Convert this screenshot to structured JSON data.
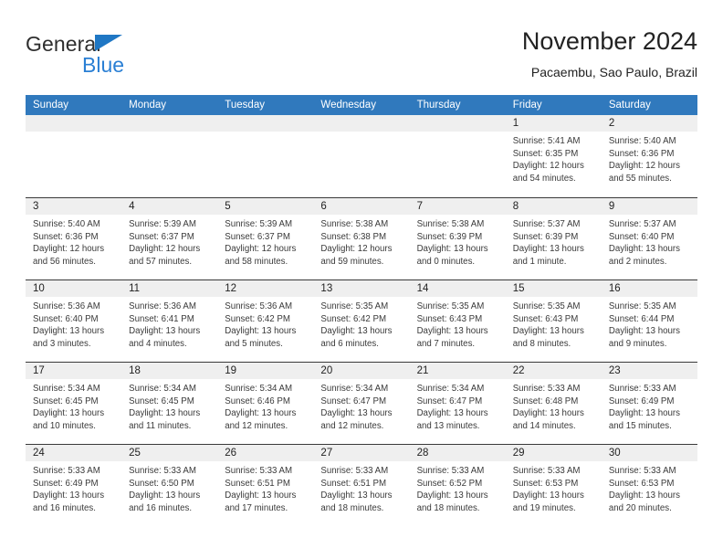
{
  "brand": {
    "name_part1": "General",
    "name_part2": "Blue",
    "triangle_color": "#1f77c4",
    "blue_color": "#2a7fd4"
  },
  "header": {
    "title": "November 2024",
    "subtitle": "Pacaembu, Sao Paulo, Brazil"
  },
  "colors": {
    "header_row_bg": "#3079bd",
    "day_band_bg": "#efefef",
    "cell_bg": "#ffffff",
    "grid_line": "#3a3a3a",
    "text": "#3a3a3a"
  },
  "weekdays": [
    "Sunday",
    "Monday",
    "Tuesday",
    "Wednesday",
    "Thursday",
    "Friday",
    "Saturday"
  ],
  "weeks": [
    [
      {
        "day": "",
        "sunrise": "",
        "sunset": "",
        "daylight_line1": "",
        "daylight_line2": ""
      },
      {
        "day": "",
        "sunrise": "",
        "sunset": "",
        "daylight_line1": "",
        "daylight_line2": ""
      },
      {
        "day": "",
        "sunrise": "",
        "sunset": "",
        "daylight_line1": "",
        "daylight_line2": ""
      },
      {
        "day": "",
        "sunrise": "",
        "sunset": "",
        "daylight_line1": "",
        "daylight_line2": ""
      },
      {
        "day": "",
        "sunrise": "",
        "sunset": "",
        "daylight_line1": "",
        "daylight_line2": ""
      },
      {
        "day": "1",
        "sunrise": "Sunrise: 5:41 AM",
        "sunset": "Sunset: 6:35 PM",
        "daylight_line1": "Daylight: 12 hours",
        "daylight_line2": "and 54 minutes."
      },
      {
        "day": "2",
        "sunrise": "Sunrise: 5:40 AM",
        "sunset": "Sunset: 6:36 PM",
        "daylight_line1": "Daylight: 12 hours",
        "daylight_line2": "and 55 minutes."
      }
    ],
    [
      {
        "day": "3",
        "sunrise": "Sunrise: 5:40 AM",
        "sunset": "Sunset: 6:36 PM",
        "daylight_line1": "Daylight: 12 hours",
        "daylight_line2": "and 56 minutes."
      },
      {
        "day": "4",
        "sunrise": "Sunrise: 5:39 AM",
        "sunset": "Sunset: 6:37 PM",
        "daylight_line1": "Daylight: 12 hours",
        "daylight_line2": "and 57 minutes."
      },
      {
        "day": "5",
        "sunrise": "Sunrise: 5:39 AM",
        "sunset": "Sunset: 6:37 PM",
        "daylight_line1": "Daylight: 12 hours",
        "daylight_line2": "and 58 minutes."
      },
      {
        "day": "6",
        "sunrise": "Sunrise: 5:38 AM",
        "sunset": "Sunset: 6:38 PM",
        "daylight_line1": "Daylight: 12 hours",
        "daylight_line2": "and 59 minutes."
      },
      {
        "day": "7",
        "sunrise": "Sunrise: 5:38 AM",
        "sunset": "Sunset: 6:39 PM",
        "daylight_line1": "Daylight: 13 hours",
        "daylight_line2": "and 0 minutes."
      },
      {
        "day": "8",
        "sunrise": "Sunrise: 5:37 AM",
        "sunset": "Sunset: 6:39 PM",
        "daylight_line1": "Daylight: 13 hours",
        "daylight_line2": "and 1 minute."
      },
      {
        "day": "9",
        "sunrise": "Sunrise: 5:37 AM",
        "sunset": "Sunset: 6:40 PM",
        "daylight_line1": "Daylight: 13 hours",
        "daylight_line2": "and 2 minutes."
      }
    ],
    [
      {
        "day": "10",
        "sunrise": "Sunrise: 5:36 AM",
        "sunset": "Sunset: 6:40 PM",
        "daylight_line1": "Daylight: 13 hours",
        "daylight_line2": "and 3 minutes."
      },
      {
        "day": "11",
        "sunrise": "Sunrise: 5:36 AM",
        "sunset": "Sunset: 6:41 PM",
        "daylight_line1": "Daylight: 13 hours",
        "daylight_line2": "and 4 minutes."
      },
      {
        "day": "12",
        "sunrise": "Sunrise: 5:36 AM",
        "sunset": "Sunset: 6:42 PM",
        "daylight_line1": "Daylight: 13 hours",
        "daylight_line2": "and 5 minutes."
      },
      {
        "day": "13",
        "sunrise": "Sunrise: 5:35 AM",
        "sunset": "Sunset: 6:42 PM",
        "daylight_line1": "Daylight: 13 hours",
        "daylight_line2": "and 6 minutes."
      },
      {
        "day": "14",
        "sunrise": "Sunrise: 5:35 AM",
        "sunset": "Sunset: 6:43 PM",
        "daylight_line1": "Daylight: 13 hours",
        "daylight_line2": "and 7 minutes."
      },
      {
        "day": "15",
        "sunrise": "Sunrise: 5:35 AM",
        "sunset": "Sunset: 6:43 PM",
        "daylight_line1": "Daylight: 13 hours",
        "daylight_line2": "and 8 minutes."
      },
      {
        "day": "16",
        "sunrise": "Sunrise: 5:35 AM",
        "sunset": "Sunset: 6:44 PM",
        "daylight_line1": "Daylight: 13 hours",
        "daylight_line2": "and 9 minutes."
      }
    ],
    [
      {
        "day": "17",
        "sunrise": "Sunrise: 5:34 AM",
        "sunset": "Sunset: 6:45 PM",
        "daylight_line1": "Daylight: 13 hours",
        "daylight_line2": "and 10 minutes."
      },
      {
        "day": "18",
        "sunrise": "Sunrise: 5:34 AM",
        "sunset": "Sunset: 6:45 PM",
        "daylight_line1": "Daylight: 13 hours",
        "daylight_line2": "and 11 minutes."
      },
      {
        "day": "19",
        "sunrise": "Sunrise: 5:34 AM",
        "sunset": "Sunset: 6:46 PM",
        "daylight_line1": "Daylight: 13 hours",
        "daylight_line2": "and 12 minutes."
      },
      {
        "day": "20",
        "sunrise": "Sunrise: 5:34 AM",
        "sunset": "Sunset: 6:47 PM",
        "daylight_line1": "Daylight: 13 hours",
        "daylight_line2": "and 12 minutes."
      },
      {
        "day": "21",
        "sunrise": "Sunrise: 5:34 AM",
        "sunset": "Sunset: 6:47 PM",
        "daylight_line1": "Daylight: 13 hours",
        "daylight_line2": "and 13 minutes."
      },
      {
        "day": "22",
        "sunrise": "Sunrise: 5:33 AM",
        "sunset": "Sunset: 6:48 PM",
        "daylight_line1": "Daylight: 13 hours",
        "daylight_line2": "and 14 minutes."
      },
      {
        "day": "23",
        "sunrise": "Sunrise: 5:33 AM",
        "sunset": "Sunset: 6:49 PM",
        "daylight_line1": "Daylight: 13 hours",
        "daylight_line2": "and 15 minutes."
      }
    ],
    [
      {
        "day": "24",
        "sunrise": "Sunrise: 5:33 AM",
        "sunset": "Sunset: 6:49 PM",
        "daylight_line1": "Daylight: 13 hours",
        "daylight_line2": "and 16 minutes."
      },
      {
        "day": "25",
        "sunrise": "Sunrise: 5:33 AM",
        "sunset": "Sunset: 6:50 PM",
        "daylight_line1": "Daylight: 13 hours",
        "daylight_line2": "and 16 minutes."
      },
      {
        "day": "26",
        "sunrise": "Sunrise: 5:33 AM",
        "sunset": "Sunset: 6:51 PM",
        "daylight_line1": "Daylight: 13 hours",
        "daylight_line2": "and 17 minutes."
      },
      {
        "day": "27",
        "sunrise": "Sunrise: 5:33 AM",
        "sunset": "Sunset: 6:51 PM",
        "daylight_line1": "Daylight: 13 hours",
        "daylight_line2": "and 18 minutes."
      },
      {
        "day": "28",
        "sunrise": "Sunrise: 5:33 AM",
        "sunset": "Sunset: 6:52 PM",
        "daylight_line1": "Daylight: 13 hours",
        "daylight_line2": "and 18 minutes."
      },
      {
        "day": "29",
        "sunrise": "Sunrise: 5:33 AM",
        "sunset": "Sunset: 6:53 PM",
        "daylight_line1": "Daylight: 13 hours",
        "daylight_line2": "and 19 minutes."
      },
      {
        "day": "30",
        "sunrise": "Sunrise: 5:33 AM",
        "sunset": "Sunset: 6:53 PM",
        "daylight_line1": "Daylight: 13 hours",
        "daylight_line2": "and 20 minutes."
      }
    ]
  ]
}
